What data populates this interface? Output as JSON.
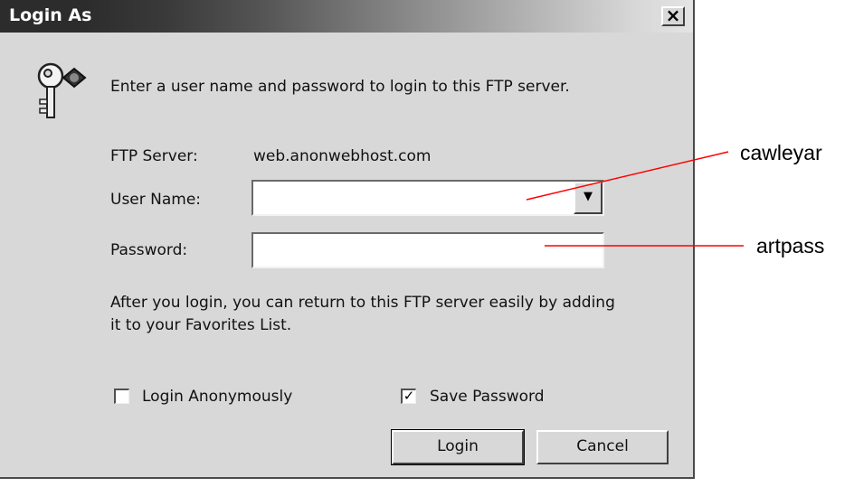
{
  "window": {
    "title": "Login As",
    "close_glyph": "×"
  },
  "icon": {
    "name": "key-icon"
  },
  "intro_text": "Enter a user name and password to login to this FTP server.",
  "server": {
    "label": "FTP Server:",
    "value": "web.anonwebhost.com"
  },
  "user_name": {
    "label": "User Name:",
    "value": "",
    "dropdown_glyph": "▼"
  },
  "password": {
    "label": "Password:",
    "value": ""
  },
  "note_text": "After you login, you can return to this FTP server easily by adding it to your Favorites List.",
  "options": {
    "login_anonymously": {
      "label": "Login Anonymously",
      "checked": false
    },
    "save_password": {
      "label": "Save Password",
      "checked": true,
      "check_glyph": "✓"
    }
  },
  "buttons": {
    "login": "Login",
    "cancel": "Cancel"
  },
  "annotations": {
    "user_name": "cawleyar",
    "password": "artpass"
  },
  "colors": {
    "dialog_bg": "#d8d8d8",
    "title_dark": "#2c2c2c",
    "leader_line": "#ff0000"
  }
}
